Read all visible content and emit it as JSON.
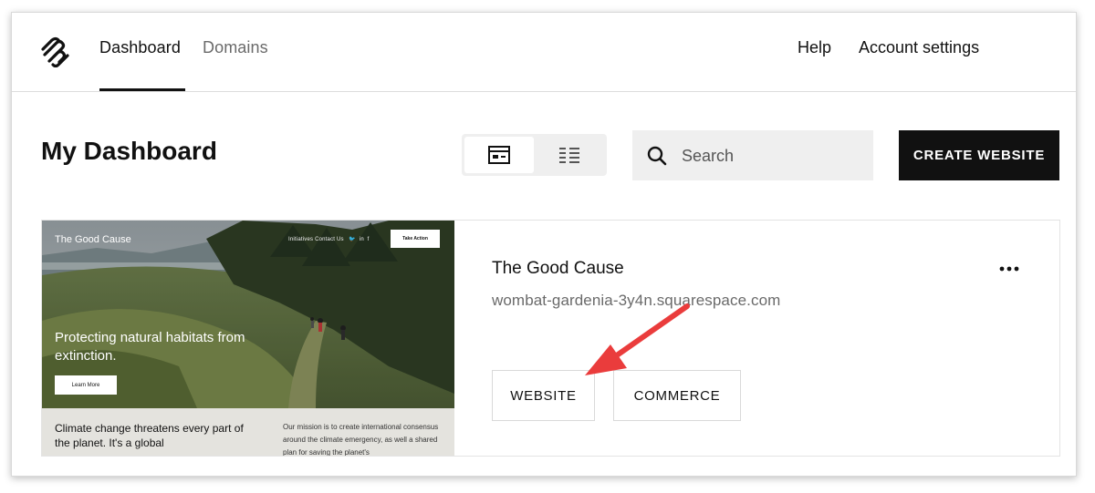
{
  "nav": {
    "tabs": [
      {
        "label": "Dashboard",
        "active": true
      },
      {
        "label": "Domains",
        "active": false
      }
    ],
    "help_label": "Help",
    "account_label": "Account settings"
  },
  "page_title": "My Dashboard",
  "search": {
    "placeholder": "Search",
    "value": ""
  },
  "create_button": "CREATE WEBSITE",
  "site": {
    "title": "The Good Cause",
    "url": "wombat-gardenia-3y4n.squarespace.com",
    "tags": [
      "WEBSITE",
      "COMMERCE"
    ],
    "preview": {
      "site_name": "The Good Cause",
      "links": "Initiatives   Contact Us",
      "action_label": "Take Action",
      "headline": "Protecting natural habitats from extinction.",
      "learn_label": "Learn More",
      "body": "Climate change threatens every part of the planet. It's a global",
      "mission": "Our mission is to create international consensus around the climate emergency, as well a shared plan for saving the planet's"
    }
  },
  "colors": {
    "primary": "#111111",
    "secondary_text": "#6a6a6a",
    "panel": "#efefef",
    "annotation_arrow": "#ea3c3c"
  }
}
